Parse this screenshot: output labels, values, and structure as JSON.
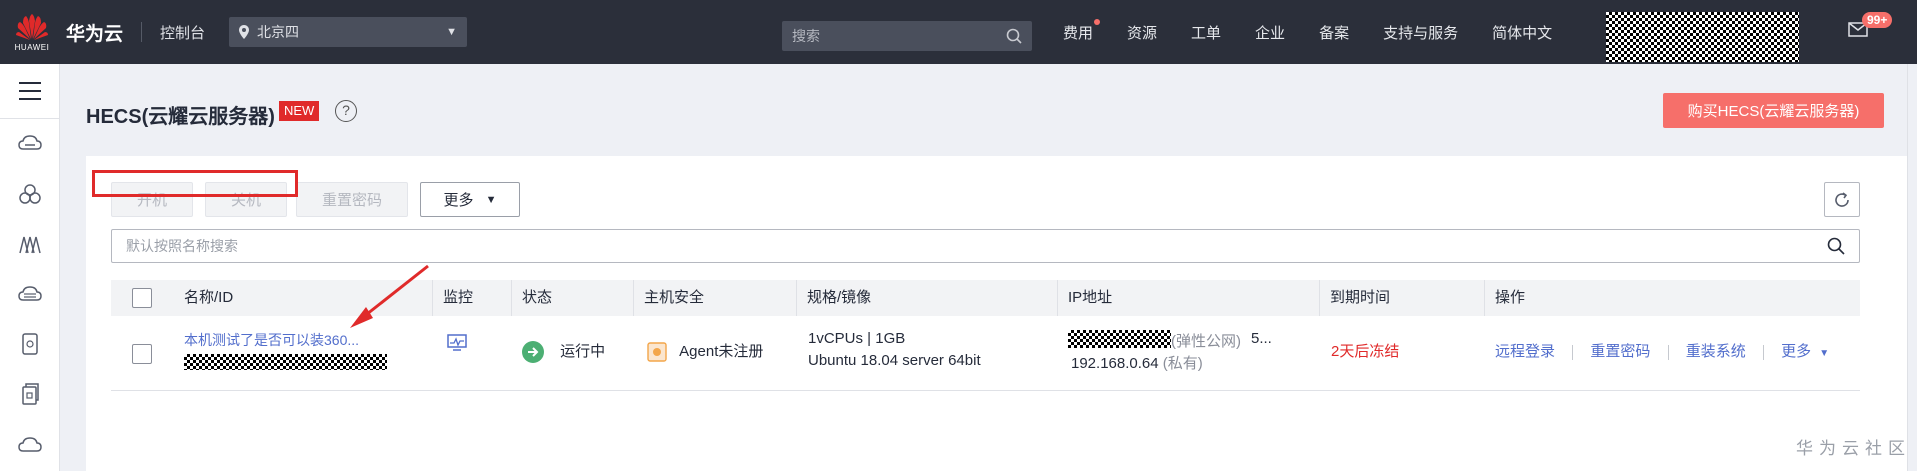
{
  "topbar": {
    "logo_text": "HUAWEI",
    "brand": "华为云",
    "console": "控制台",
    "region": "北京四",
    "search_placeholder": "搜索",
    "nav": [
      "费用",
      "资源",
      "工单",
      "企业",
      "备案",
      "支持与服务",
      "简体中文"
    ],
    "badge": "99+"
  },
  "sidebar": {
    "icons": [
      "cloud-server-icon",
      "cluster-icon",
      "network-icon",
      "database-icon",
      "storage-icon",
      "backup-icon",
      "cloud-icon"
    ]
  },
  "page": {
    "title": "HECS(云耀云服务器)",
    "new_tag": "NEW",
    "help": "?",
    "buy_button": "购买HECS(云耀云服务器)"
  },
  "toolbar": {
    "power_on": "开机",
    "power_off": "关机",
    "reset_password": "重置密码",
    "more": "更多"
  },
  "filter": {
    "placeholder": "默认按照名称搜索"
  },
  "table": {
    "headers": [
      "名称/ID",
      "监控",
      "状态",
      "主机安全",
      "规格/镜像",
      "IP地址",
      "到期时间",
      "操作"
    ],
    "row": {
      "name": "本机测试了是否可以装360...",
      "status": "运行中",
      "security": "Agent未注册",
      "spec": "1vCPUs | 1GB",
      "image": "Ubuntu 18.04 server 64bit",
      "ip_public_label": "(弹性公网)",
      "ip_public_suffix": "5...",
      "ip_private": "192.168.0.64",
      "ip_private_label": "(私有)",
      "expire": "2天后冻结",
      "ops": [
        "远程登录",
        "重置密码",
        "重装系统",
        "更多"
      ]
    }
  },
  "watermark": "华为云社区",
  "colors": {
    "topbar": "#2b2f3a",
    "buy": "#f66f6a",
    "link": "#526ecc",
    "danger": "#e02a2a",
    "running": "#4caf73"
  }
}
